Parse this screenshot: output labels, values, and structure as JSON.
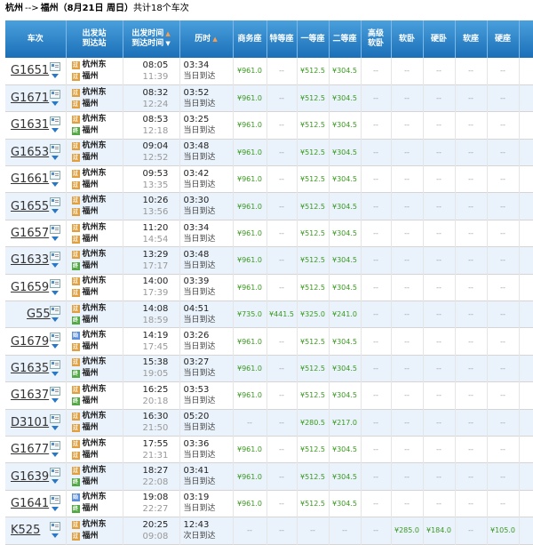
{
  "header": {
    "from": "杭州",
    "arrow": "-->",
    "to": "福州",
    "date_text": "（8月21日  周日）",
    "count_text": "共计18个车次"
  },
  "columns": {
    "train": "车次",
    "station_top": "出发站",
    "station_bottom": "到达站",
    "time_top": "出发时间",
    "time_bottom": "到达时间",
    "duration": "历时",
    "business": "商务座",
    "special": "特等座",
    "first": "一等座",
    "second": "二等座",
    "soft_sleeper_adv_top": "高级",
    "soft_sleeper_adv_bottom": "软卧",
    "soft_sleeper": "软卧",
    "hard_sleeper": "硬卧",
    "soft_seat": "软座",
    "hard_seat": "硬座"
  },
  "sort_icons": {
    "up": "▲",
    "down": "▼"
  },
  "badges": {
    "start": "始",
    "pass": "过",
    "end": "终"
  },
  "trains": [
    {
      "no": "G1651",
      "from": "杭州东",
      "from_badge": "过",
      "to": "福州",
      "to_badge": "过",
      "dep": "08:05",
      "arr": "11:39",
      "dur": "03:34",
      "note": "当日到达",
      "p": [
        "¥961.0",
        "--",
        "¥512.5",
        "¥304.5",
        "--",
        "--",
        "--",
        "--",
        "--"
      ]
    },
    {
      "no": "G1671",
      "from": "杭州东",
      "from_badge": "过",
      "to": "福州",
      "to_badge": "过",
      "dep": "08:32",
      "arr": "12:24",
      "dur": "03:52",
      "note": "当日到达",
      "p": [
        "¥961.0",
        "--",
        "¥512.5",
        "¥304.5",
        "--",
        "--",
        "--",
        "--",
        "--"
      ]
    },
    {
      "no": "G1631",
      "from": "杭州东",
      "from_badge": "过",
      "to": "福州",
      "to_badge": "终",
      "dep": "08:53",
      "arr": "12:18",
      "dur": "03:25",
      "note": "当日到达",
      "p": [
        "¥961.0",
        "--",
        "¥512.5",
        "¥304.5",
        "--",
        "--",
        "--",
        "--",
        "--"
      ]
    },
    {
      "no": "G1653",
      "from": "杭州东",
      "from_badge": "过",
      "to": "福州",
      "to_badge": "过",
      "dep": "09:04",
      "arr": "12:52",
      "dur": "03:48",
      "note": "当日到达",
      "p": [
        "¥961.0",
        "--",
        "¥512.5",
        "¥304.5",
        "--",
        "--",
        "--",
        "--",
        "--"
      ]
    },
    {
      "no": "G1661",
      "from": "杭州东",
      "from_badge": "过",
      "to": "福州",
      "to_badge": "过",
      "dep": "09:53",
      "arr": "13:35",
      "dur": "03:42",
      "note": "当日到达",
      "p": [
        "¥961.0",
        "--",
        "¥512.5",
        "¥304.5",
        "--",
        "--",
        "--",
        "--",
        "--"
      ]
    },
    {
      "no": "G1655",
      "from": "杭州东",
      "from_badge": "过",
      "to": "福州",
      "to_badge": "过",
      "dep": "10:26",
      "arr": "13:56",
      "dur": "03:30",
      "note": "当日到达",
      "p": [
        "¥961.0",
        "--",
        "¥512.5",
        "¥304.5",
        "--",
        "--",
        "--",
        "--",
        "--"
      ]
    },
    {
      "no": "G1657",
      "from": "杭州东",
      "from_badge": "过",
      "to": "福州",
      "to_badge": "过",
      "dep": "11:20",
      "arr": "14:54",
      "dur": "03:34",
      "note": "当日到达",
      "p": [
        "¥961.0",
        "--",
        "¥512.5",
        "¥304.5",
        "--",
        "--",
        "--",
        "--",
        "--"
      ]
    },
    {
      "no": "G1633",
      "from": "杭州东",
      "from_badge": "过",
      "to": "福州",
      "to_badge": "终",
      "dep": "13:29",
      "arr": "17:17",
      "dur": "03:48",
      "note": "当日到达",
      "p": [
        "¥961.0",
        "--",
        "¥512.5",
        "¥304.5",
        "--",
        "--",
        "--",
        "--",
        "--"
      ]
    },
    {
      "no": "G1659",
      "from": "杭州东",
      "from_badge": "过",
      "to": "福州",
      "to_badge": "过",
      "dep": "14:00",
      "arr": "17:39",
      "dur": "03:39",
      "note": "当日到达",
      "p": [
        "¥961.0",
        "--",
        "¥512.5",
        "¥304.5",
        "--",
        "--",
        "--",
        "--",
        "--"
      ]
    },
    {
      "no": "G55",
      "from": "杭州东",
      "from_badge": "过",
      "to": "福州",
      "to_badge": "终",
      "dep": "14:08",
      "arr": "18:59",
      "dur": "04:51",
      "note": "当日到达",
      "p": [
        "¥735.0",
        "¥441.5",
        "¥325.0",
        "¥241.0",
        "--",
        "--",
        "--",
        "--",
        "--"
      ]
    },
    {
      "no": "G1679",
      "from": "杭州东",
      "from_badge": "始",
      "to": "福州",
      "to_badge": "过",
      "dep": "14:19",
      "arr": "17:45",
      "dur": "03:26",
      "note": "当日到达",
      "p": [
        "¥961.0",
        "--",
        "¥512.5",
        "¥304.5",
        "--",
        "--",
        "--",
        "--",
        "--"
      ]
    },
    {
      "no": "G1635",
      "from": "杭州东",
      "from_badge": "过",
      "to": "福州",
      "to_badge": "终",
      "dep": "15:38",
      "arr": "19:05",
      "dur": "03:27",
      "note": "当日到达",
      "p": [
        "¥961.0",
        "--",
        "¥512.5",
        "¥304.5",
        "--",
        "--",
        "--",
        "--",
        "--"
      ]
    },
    {
      "no": "G1637",
      "from": "杭州东",
      "from_badge": "过",
      "to": "福州",
      "to_badge": "终",
      "dep": "16:25",
      "arr": "20:18",
      "dur": "03:53",
      "note": "当日到达",
      "p": [
        "¥961.0",
        "--",
        "¥512.5",
        "¥304.5",
        "--",
        "--",
        "--",
        "--",
        "--"
      ]
    },
    {
      "no": "D3101",
      "from": "杭州东",
      "from_badge": "过",
      "to": "福州",
      "to_badge": "过",
      "dep": "16:30",
      "arr": "21:50",
      "dur": "05:20",
      "note": "当日到达",
      "p": [
        "--",
        "--",
        "¥280.5",
        "¥217.0",
        "--",
        "--",
        "--",
        "--",
        "--"
      ]
    },
    {
      "no": "G1677",
      "from": "杭州东",
      "from_badge": "过",
      "to": "福州",
      "to_badge": "过",
      "dep": "17:55",
      "arr": "21:31",
      "dur": "03:36",
      "note": "当日到达",
      "p": [
        "¥961.0",
        "--",
        "¥512.5",
        "¥304.5",
        "--",
        "--",
        "--",
        "--",
        "--"
      ]
    },
    {
      "no": "G1639",
      "from": "杭州东",
      "from_badge": "过",
      "to": "福州",
      "to_badge": "终",
      "dep": "18:27",
      "arr": "22:08",
      "dur": "03:41",
      "note": "当日到达",
      "p": [
        "¥961.0",
        "--",
        "¥512.5",
        "¥304.5",
        "--",
        "--",
        "--",
        "--",
        "--"
      ]
    },
    {
      "no": "G1641",
      "from": "杭州东",
      "from_badge": "始",
      "to": "福州",
      "to_badge": "终",
      "dep": "19:08",
      "arr": "22:27",
      "dur": "03:19",
      "note": "当日到达",
      "p": [
        "¥961.0",
        "--",
        "¥512.5",
        "¥304.5",
        "--",
        "--",
        "--",
        "--",
        "--"
      ]
    },
    {
      "no": "K525",
      "from": "杭州东",
      "from_badge": "过",
      "to": "福州",
      "to_badge": "过",
      "dep": "20:25",
      "arr": "09:08",
      "dur": "12:43",
      "note": "次日到达",
      "p": [
        "--",
        "--",
        "--",
        "--",
        "--",
        "¥285.0",
        "¥184.0",
        "--",
        "¥105.0"
      ]
    }
  ]
}
